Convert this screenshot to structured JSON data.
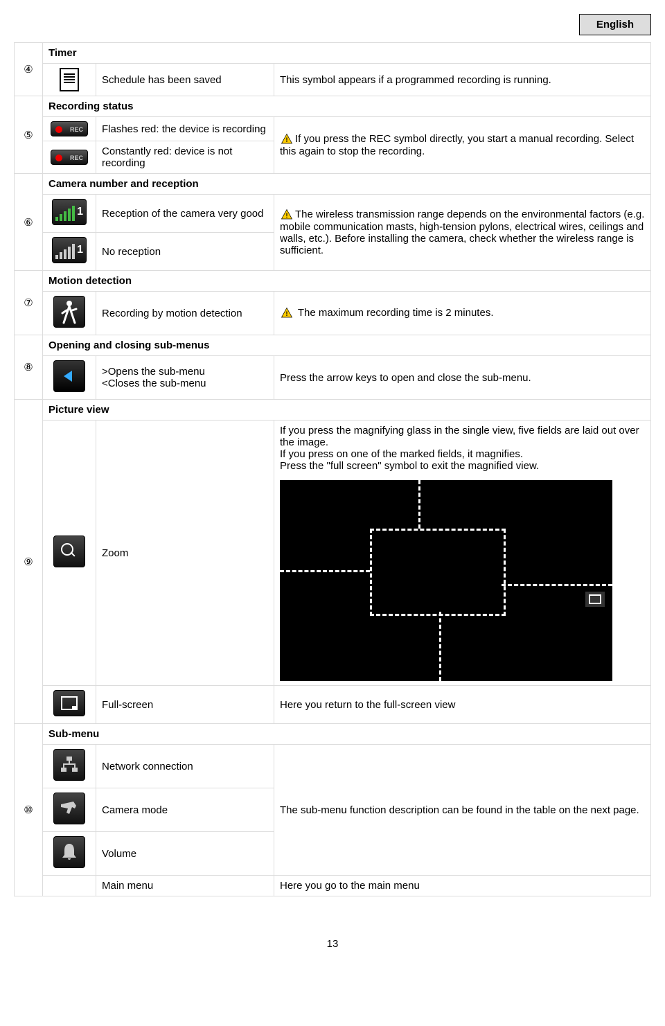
{
  "language_label": "English",
  "page_number": "13",
  "sections": {
    "timer": {
      "header": "Timer",
      "num": "④",
      "r1_label": "Schedule has been saved",
      "r1_desc": "This symbol appears if a programmed recording is running."
    },
    "recording": {
      "header": "Recording status",
      "num": "⑤",
      "r1_label": "Flashes red: the device is recording",
      "r2_label": "Constantly red: device is not recording",
      "desc": "If you press the REC symbol directly, you start a manual recording. Select this again to stop the recording."
    },
    "camera": {
      "header": "Camera number and reception",
      "num": "⑥",
      "r1_label": "Reception of the camera very good",
      "r2_label": "No reception",
      "desc": "The wireless transmission range depends on the environmental factors (e.g. mobile communication masts, high-tension pylons, electrical wires, ceilings and walls, etc.). Before installing the camera, check whether the wireless range is sufficient.",
      "signal_num": "1"
    },
    "motion": {
      "header": "Motion detection",
      "num": "⑦",
      "r1_label": "Recording by motion detection",
      "desc": " The maximum recording time is 2 minutes."
    },
    "submenu_oc": {
      "header": "Opening and closing sub-menus",
      "num": "⑧",
      "r1_label": ">Opens the sub-menu\n<Closes the sub-menu",
      "desc": "Press the arrow keys to open and close the sub-menu."
    },
    "picture": {
      "header": "Picture view",
      "num": "⑨",
      "zoom_label": "Zoom",
      "zoom_desc": "If you press the magnifying glass in the single view, five fields are laid out over the image.\nIf you press on one of the marked fields, it magnifies.\nPress the \"full screen\" symbol to exit the magnified view.",
      "full_label": "Full-screen",
      "full_desc": "Here you return to the full-screen view"
    },
    "submenu": {
      "header": "Sub-menu",
      "num": "⑩",
      "net_label": "Network connection",
      "cam_label": "Camera mode",
      "vol_label": "Volume",
      "main_label": "Main menu",
      "desc": "The sub-menu function description can be found in the table on the next page.",
      "main_desc": "Here you go to the main menu"
    }
  },
  "icons": {
    "rec_text": "REC"
  }
}
